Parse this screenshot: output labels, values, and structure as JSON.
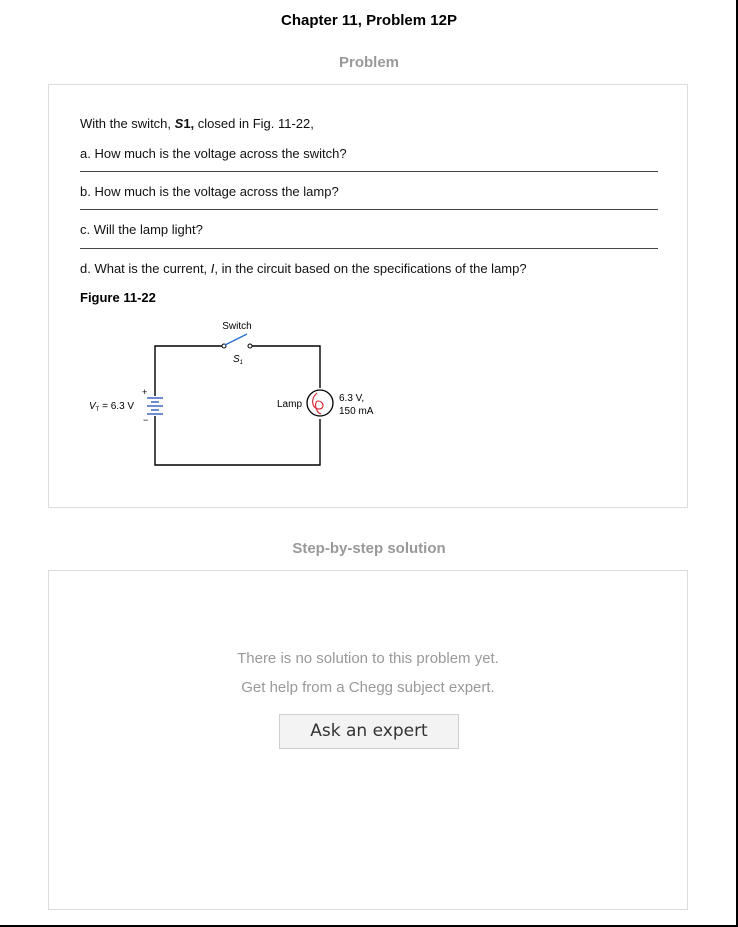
{
  "header": {
    "title": "Chapter 11, Problem 12P"
  },
  "problem": {
    "section_label": "Problem",
    "intro_prefix": "With the switch, ",
    "intro_switch": "S",
    "intro_switch_sub": "1,",
    "intro_suffix": " closed in Fig. 11-22,",
    "qa": "a. How much is the voltage across the switch?",
    "qb": "b. How much is the voltage across the lamp?",
    "qc": "c. Will the lamp light?",
    "qd_prefix": "d. What is the current, ",
    "qd_var": "I",
    "qd_suffix": ", in the circuit based on the specifications of the lamp?",
    "figure_label": "Figure 11-22"
  },
  "figure": {
    "switch_label": "Switch",
    "switch_name": "S",
    "switch_sub": "1",
    "voltage_var": "V",
    "voltage_sub": "T",
    "voltage_value": " = 6.3 V",
    "plus": "+",
    "minus": "−",
    "lamp_label": "Lamp",
    "lamp_rating_1": "6.3 V,",
    "lamp_rating_2": "150 mA",
    "wire_color": "#000000",
    "switch_color": "#2a6fd6",
    "filament_color": "#d6202a",
    "battery_color": "#1f4fb5"
  },
  "solution": {
    "section_label": "Step-by-step solution",
    "line1": "There is no solution to this problem yet.",
    "line2": "Get help from a Chegg subject expert.",
    "button_label": "Ask an expert"
  }
}
